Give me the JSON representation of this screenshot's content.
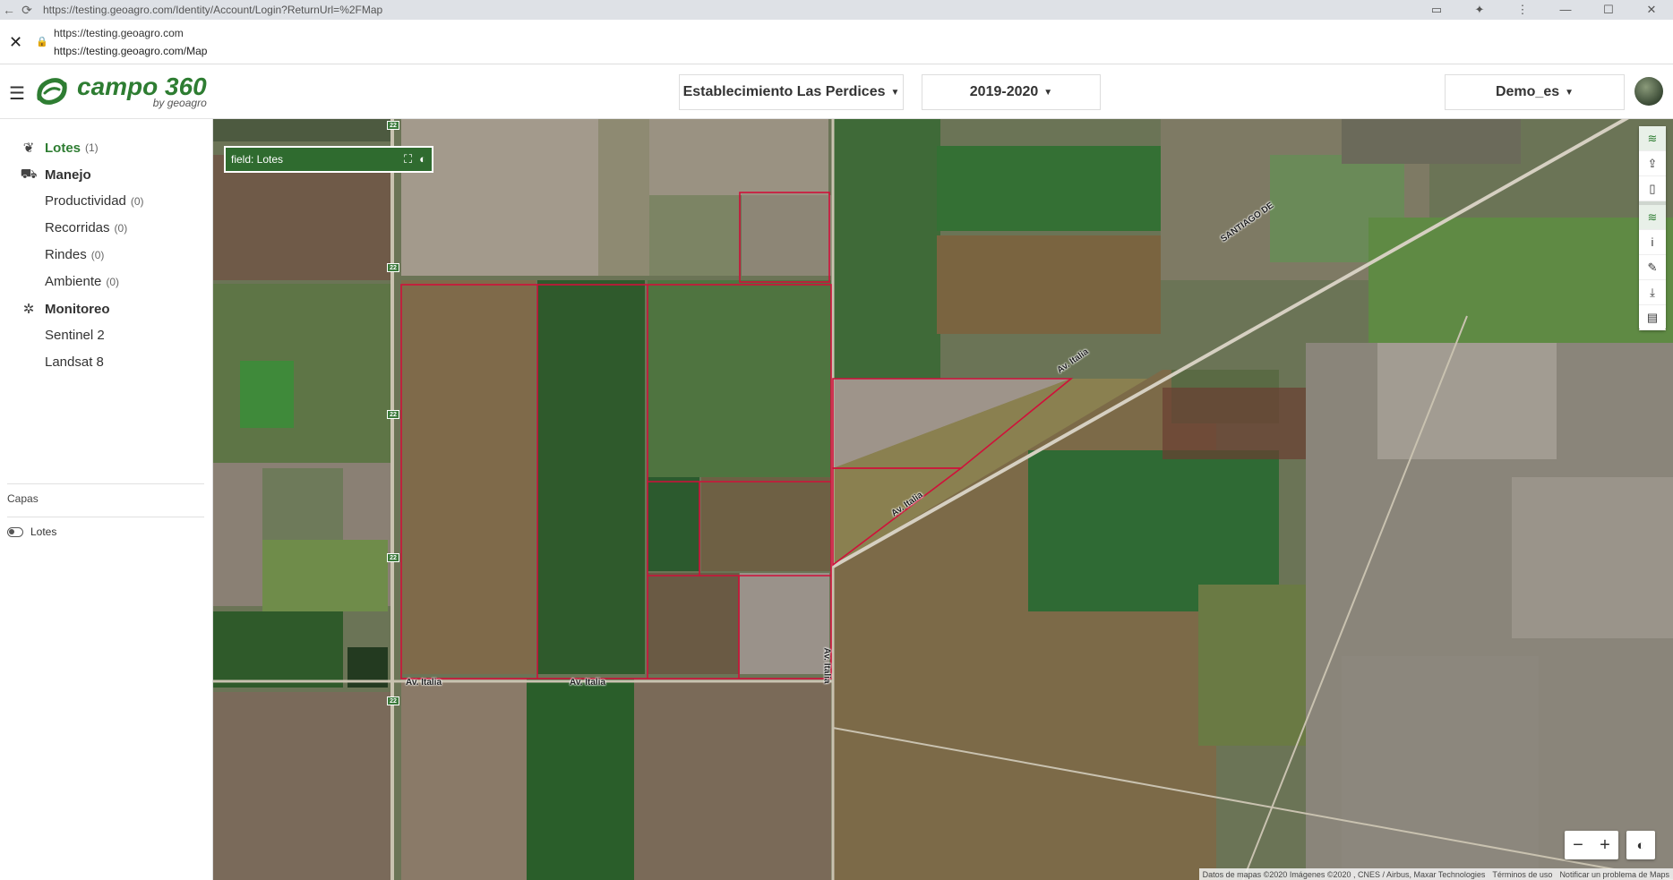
{
  "browser": {
    "top_url": "https://testing.geoagro.com/Identity/Account/Login?ReturnUrl=%2FMap",
    "popup_url_1": "https://testing.geoagro.com",
    "popup_url_2": "https://testing.geoagro.com/Map"
  },
  "header": {
    "logo_main": "campo 360",
    "logo_sub": "by geoagro",
    "establishment": "Establecimiento Las Perdices",
    "season": "2019-2020",
    "user": "Demo_es"
  },
  "sidebar": {
    "lotes": {
      "label": "Lotes",
      "count": "(1)"
    },
    "manejo": {
      "label": "Manejo"
    },
    "manejo_items": [
      {
        "label": "Productividad",
        "count": "(0)"
      },
      {
        "label": "Recorridas",
        "count": "(0)"
      },
      {
        "label": "Rindes",
        "count": "(0)"
      },
      {
        "label": "Ambiente",
        "count": "(0)"
      }
    ],
    "monitoreo": {
      "label": "Monitoreo"
    },
    "monitoreo_items": [
      {
        "label": "Sentinel 2"
      },
      {
        "label": "Landsat 8"
      }
    ],
    "capas_label": "Capas",
    "layer_toggle_label": "Lotes"
  },
  "map": {
    "field_label": "field: Lotes",
    "road_labels": [
      "Av. Italia",
      "Av. Italia",
      "Av. Italia",
      "Av. Italia",
      "Av. Italia",
      "SANTIAGO DE"
    ],
    "route_number": "22",
    "zoom_out": "−",
    "zoom_in": "+",
    "attribution": [
      "Datos de mapas ©2020 Imágenes ©2020 , CNES / Airbus, Maxar Technologies",
      "Términos de uso",
      "Notificar un problema de Maps"
    ]
  },
  "colors": {
    "brand": "#2e7d32",
    "field_outline": "#d0103a"
  }
}
